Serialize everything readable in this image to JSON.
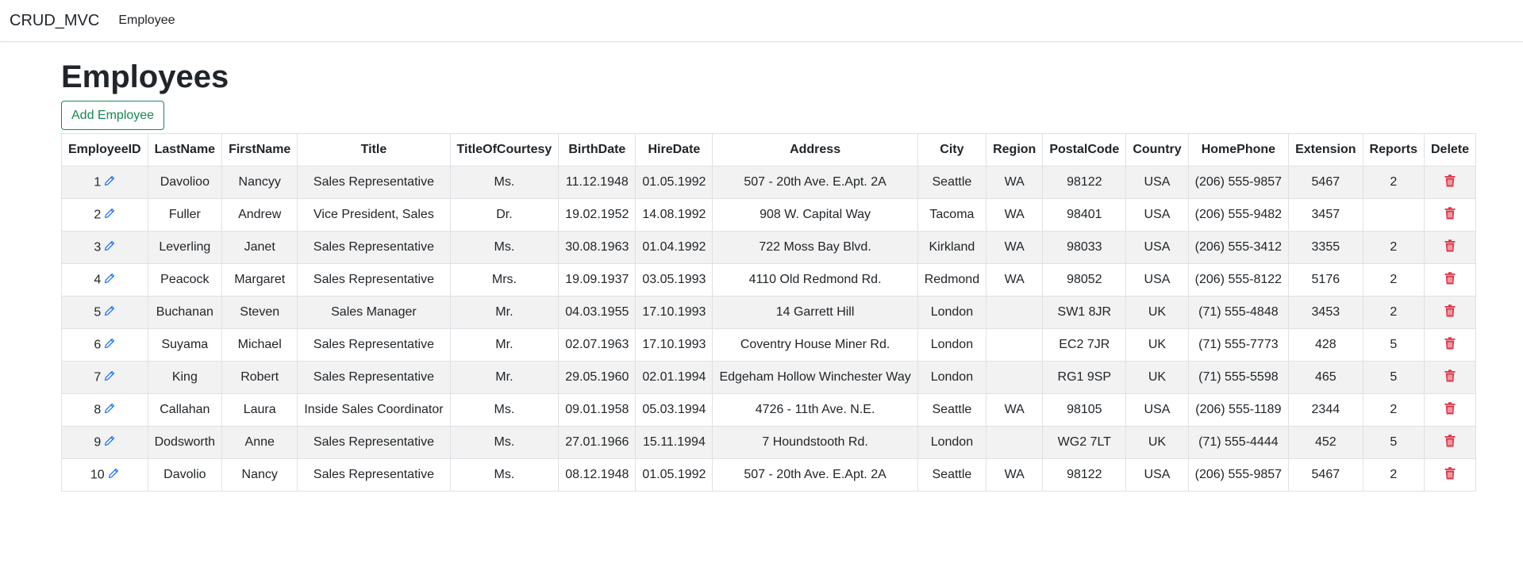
{
  "navbar": {
    "brand": "CRUD_MVC",
    "links": [
      "Employee"
    ]
  },
  "page": {
    "title": "Employees",
    "add_button": "Add Employee"
  },
  "colors": {
    "edit_icon": "#0d6efd",
    "delete_icon": "#dc3545",
    "add_button": "#198754"
  },
  "icons": {
    "edit": "pencil-icon",
    "delete": "trash-icon"
  },
  "table": {
    "headers": [
      "EmployeeID",
      "LastName",
      "FirstName",
      "Title",
      "TitleOfCourtesy",
      "BirthDate",
      "HireDate",
      "Address",
      "City",
      "Region",
      "PostalCode",
      "Country",
      "HomePhone",
      "Extension",
      "Reports",
      "Delete"
    ],
    "rows": [
      [
        "1",
        "Davolioo",
        "Nancyy",
        "Sales Representative",
        "Ms.",
        "11.12.1948",
        "01.05.1992",
        "507 - 20th Ave. E.Apt. 2A",
        "Seattle",
        "WA",
        "98122",
        "USA",
        "(206) 555-9857",
        "5467",
        "2"
      ],
      [
        "2",
        "Fuller",
        "Andrew",
        "Vice President, Sales",
        "Dr.",
        "19.02.1952",
        "14.08.1992",
        "908 W. Capital Way",
        "Tacoma",
        "WA",
        "98401",
        "USA",
        "(206) 555-9482",
        "3457",
        ""
      ],
      [
        "3",
        "Leverling",
        "Janet",
        "Sales Representative",
        "Ms.",
        "30.08.1963",
        "01.04.1992",
        "722 Moss Bay Blvd.",
        "Kirkland",
        "WA",
        "98033",
        "USA",
        "(206) 555-3412",
        "3355",
        "2"
      ],
      [
        "4",
        "Peacock",
        "Margaret",
        "Sales Representative",
        "Mrs.",
        "19.09.1937",
        "03.05.1993",
        "4110 Old Redmond Rd.",
        "Redmond",
        "WA",
        "98052",
        "USA",
        "(206) 555-8122",
        "5176",
        "2"
      ],
      [
        "5",
        "Buchanan",
        "Steven",
        "Sales Manager",
        "Mr.",
        "04.03.1955",
        "17.10.1993",
        "14 Garrett Hill",
        "London",
        "",
        "SW1 8JR",
        "UK",
        "(71) 555-4848",
        "3453",
        "2"
      ],
      [
        "6",
        "Suyama",
        "Michael",
        "Sales Representative",
        "Mr.",
        "02.07.1963",
        "17.10.1993",
        "Coventry House Miner Rd.",
        "London",
        "",
        "EC2 7JR",
        "UK",
        "(71) 555-7773",
        "428",
        "5"
      ],
      [
        "7",
        "King",
        "Robert",
        "Sales Representative",
        "Mr.",
        "29.05.1960",
        "02.01.1994",
        "Edgeham Hollow Winchester Way",
        "London",
        "",
        "RG1 9SP",
        "UK",
        "(71) 555-5598",
        "465",
        "5"
      ],
      [
        "8",
        "Callahan",
        "Laura",
        "Inside Sales Coordinator",
        "Ms.",
        "09.01.1958",
        "05.03.1994",
        "4726 - 11th Ave. N.E.",
        "Seattle",
        "WA",
        "98105",
        "USA",
        "(206) 555-1189",
        "2344",
        "2"
      ],
      [
        "9",
        "Dodsworth",
        "Anne",
        "Sales Representative",
        "Ms.",
        "27.01.1966",
        "15.11.1994",
        "7 Houndstooth Rd.",
        "London",
        "",
        "WG2 7LT",
        "UK",
        "(71) 555-4444",
        "452",
        "5"
      ],
      [
        "10",
        "Davolio",
        "Nancy",
        "Sales Representative",
        "Ms.",
        "08.12.1948",
        "01.05.1992",
        "507 - 20th Ave. E.Apt. 2A",
        "Seattle",
        "WA",
        "98122",
        "USA",
        "(206) 555-9857",
        "5467",
        "2"
      ]
    ]
  }
}
